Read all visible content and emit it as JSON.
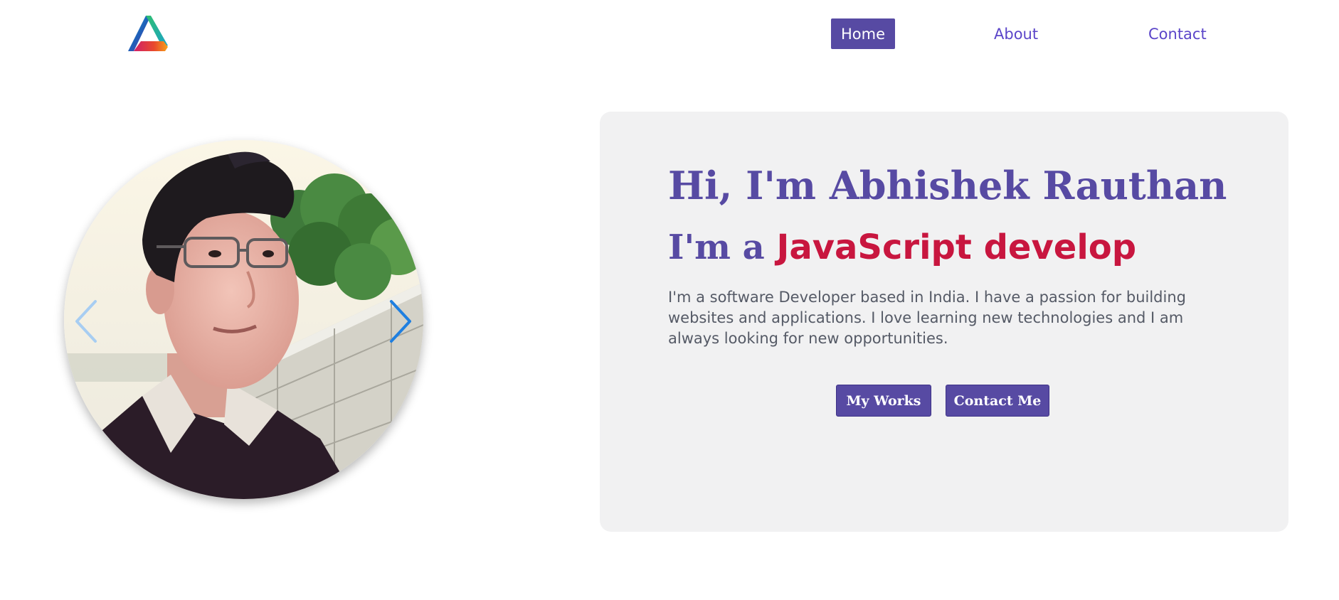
{
  "header": {
    "logo": {
      "icon": "triangle-logo-icon"
    },
    "nav": {
      "home_label": "Home",
      "about_label": "About",
      "contact_label": "Contact"
    }
  },
  "hero": {
    "avatar": {
      "prev_icon": "chevron-left-icon",
      "next_icon": "chevron-right-icon"
    },
    "greeting": "Hi, I'm Abhishek Rauthan",
    "role_prefix": "I'm a",
    "role_typed": "JavaScript develop",
    "bio": "I'm a software Developer based in India. I have a passion for building websites and applications. I love learning new technologies and I am always looking for new opportunities.",
    "buttons": {
      "works_label": "My Works",
      "contact_label": "Contact Me"
    }
  },
  "colors": {
    "brand": "#574aa3",
    "nav_link": "#5b45c9",
    "accent_red": "#c8163f",
    "card_bg": "#f1f1f2",
    "text_muted": "#555a66",
    "chevron_blue": "#1f7fe0"
  }
}
